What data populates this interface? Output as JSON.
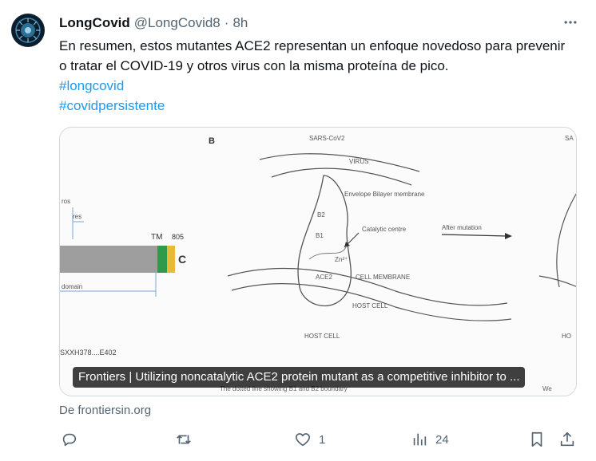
{
  "tweet": {
    "author_name": "LongCovid",
    "handle": "@LongCovid8",
    "separator": "·",
    "time": "8h",
    "text": "En resumen, estos mutantes ACE2 representan un enfoque novedoso para prevenir o tratar el COVID-19 y otros virus con la misma proteína de pico.",
    "hashtags": [
      "#longcovid",
      "#covidpersistente"
    ]
  },
  "card": {
    "caption": "Frontiers | Utilizing noncatalytic ACE2 protein mutant as a competitive inhibitor to ...",
    "source": "De frontiersin.org",
    "figure_labels": {
      "panel": "B",
      "sars": "SARS-CoV2",
      "virus": "VIRUS",
      "envelope": "Envelope Bilayer membrane",
      "b2": "B2",
      "b1": "B1",
      "catalytic": "Catalytic centre",
      "after": "After mutation",
      "zn": "Zn²⁺",
      "ace2": "ACE2",
      "cell_membrane": "CELL MEMBRANE",
      "host_cell": "HOST CELL",
      "host_cell_2": "HOST CELL",
      "tm": "TM",
      "n805": "805",
      "c": "C",
      "ros": "ros",
      "res": "res",
      "domain": "domain",
      "seq": "SXXH378....E402",
      "dotted": "The dotted line showing B1 and B2 boundary",
      "right_h": "HO",
      "right_sars": "SA",
      "right_bottom": "We"
    }
  },
  "actions": {
    "reply_count": "",
    "retweet_count": "",
    "like_count": "1",
    "views_count": "24"
  }
}
